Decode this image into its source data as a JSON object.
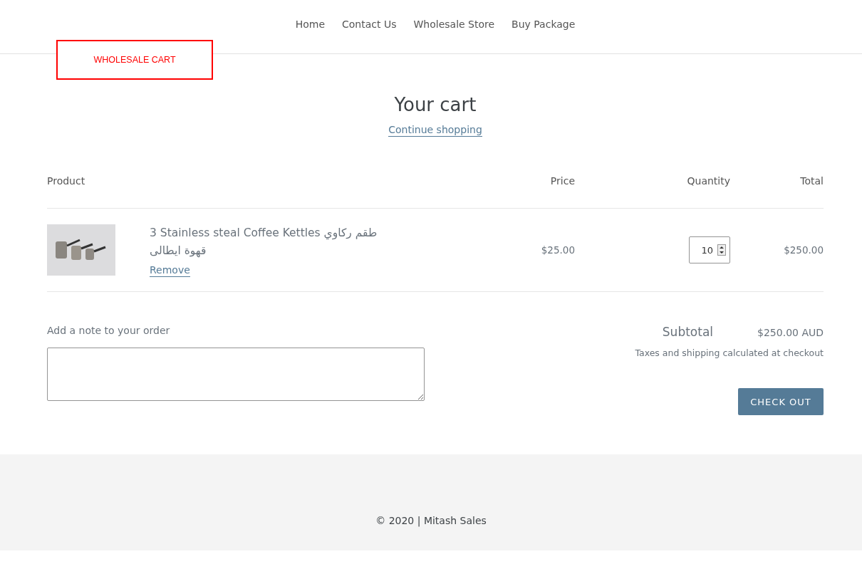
{
  "nav": {
    "items": [
      "Home",
      "Contact Us",
      "Wholesale Store",
      "Buy Package"
    ]
  },
  "wholesale_button": "WHOLESALE CART",
  "cart": {
    "title": "Your cart",
    "continue_link": "Continue shopping",
    "columns": [
      "Product",
      "Price",
      "Quantity",
      "Total"
    ],
    "items": [
      {
        "name": "3 Stainless steal Coffee Kettles طقم ركاوي قهوة ايطالى",
        "remove": "Remove",
        "price": "$25.00",
        "quantity": "10",
        "total": "$250.00"
      }
    ]
  },
  "note": {
    "label": "Add a note to your order"
  },
  "summary": {
    "subtotal_label": "Subtotal",
    "subtotal_value": "$250.00 AUD",
    "tax_note": "Taxes and shipping calculated at checkout",
    "checkout_button": "CHECK OUT"
  },
  "footer": {
    "copyright": "© 2020 | Mitash Sales"
  }
}
